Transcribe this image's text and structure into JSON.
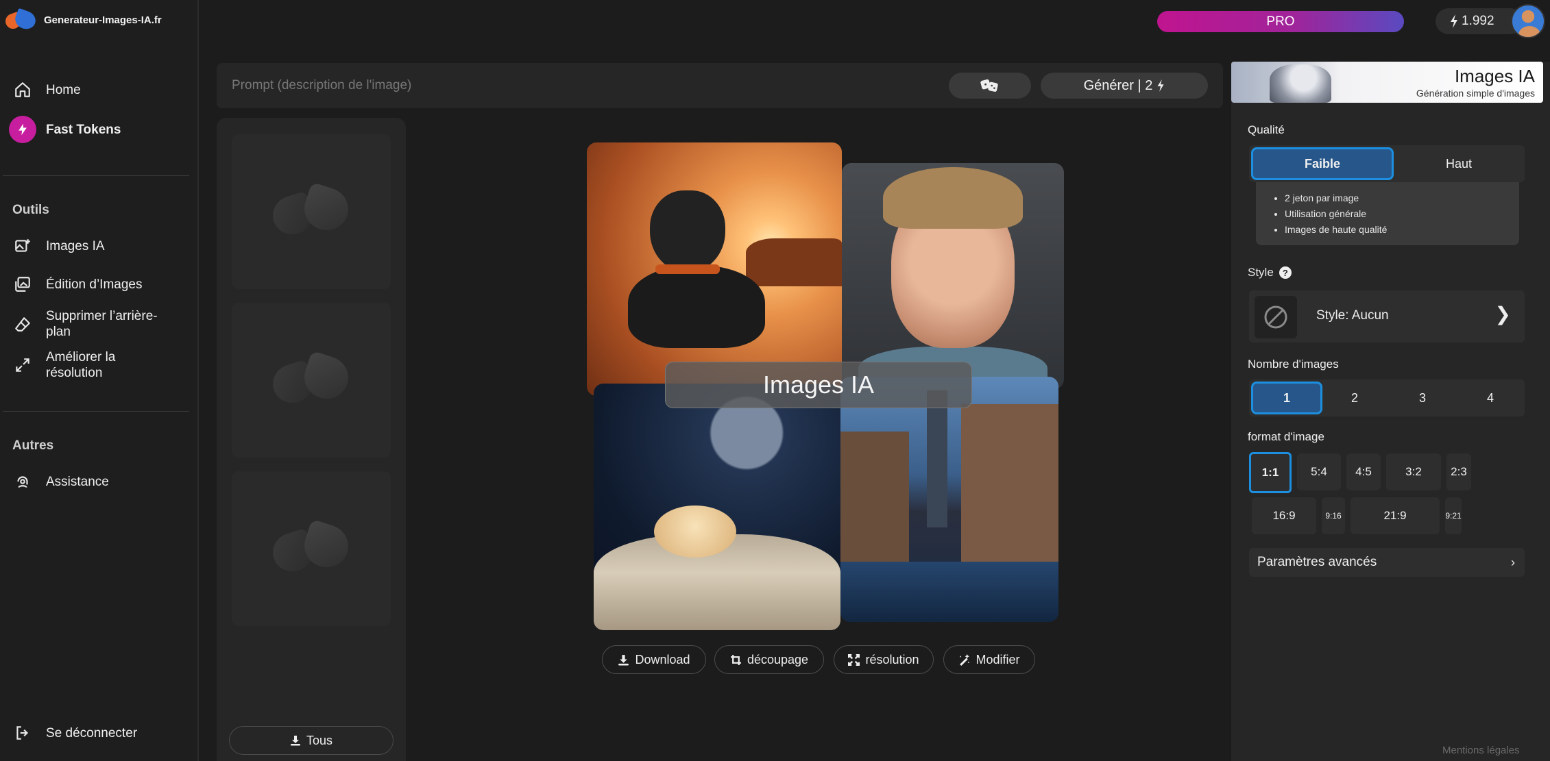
{
  "brand": {
    "site_name": "Generateur-Images-IA.fr"
  },
  "topbar": {
    "pro_label": "PRO",
    "tokens": "1.992"
  },
  "sidebar": {
    "items": [
      {
        "label": "Home",
        "icon": "home-icon"
      },
      {
        "label": "Fast Tokens",
        "icon": "bolt-icon"
      }
    ],
    "tools_title": "Outils",
    "tools": [
      {
        "label": "Images IA",
        "icon": "image-plus-icon"
      },
      {
        "label": "Édition d’Images",
        "icon": "images-edit-icon"
      },
      {
        "label": "Supprimer l’arrière-plan",
        "icon": "eraser-icon"
      },
      {
        "label": "Améliorer la résolution",
        "icon": "expand-icon"
      }
    ],
    "others_title": "Autres",
    "others": [
      {
        "label": "Assistance",
        "icon": "support-icon"
      }
    ],
    "logout_label": "Se déconnecter"
  },
  "prompt": {
    "placeholder": "Prompt (description de l'image)",
    "value": "",
    "generate_label": "Générer | 2"
  },
  "history": {
    "download_all_label": "Tous"
  },
  "collage": {
    "label": "Images IA"
  },
  "actions": {
    "download": "Download",
    "crop": "découpage",
    "resolution": "résolution",
    "modify": "Modifier"
  },
  "panel": {
    "title": "Images IA",
    "subtitle": "Génération simple d'images",
    "quality_label": "Qualité",
    "quality_options": [
      "Faible",
      "Haut"
    ],
    "quality_selected": "Faible",
    "quality_info": [
      "2 jeton par image",
      "Utilisation générale",
      "Images de haute qualité"
    ],
    "style_label": "Style",
    "style_help": "?",
    "style_value": "Style: Aucun",
    "style_chevron": "❯",
    "count_label": "Nombre d'images",
    "count_options": [
      "1",
      "2",
      "3",
      "4"
    ],
    "count_selected": "1",
    "format_label": "format d'image",
    "format_options": [
      "1:1",
      "5:4",
      "4:5",
      "3:2",
      "2:3",
      "16:9",
      "9:16",
      "21:9",
      "9:21"
    ],
    "format_selected": "1:1",
    "advanced_label": "Paramètres avancés",
    "advanced_chevron": "›"
  },
  "footer": {
    "legal": "Mentions légales"
  },
  "colors": {
    "accent": "#1c8fe0",
    "pro_start": "#c0148f",
    "pro_end": "#5a4ac0",
    "fast_tokens": "#c61e9e"
  }
}
